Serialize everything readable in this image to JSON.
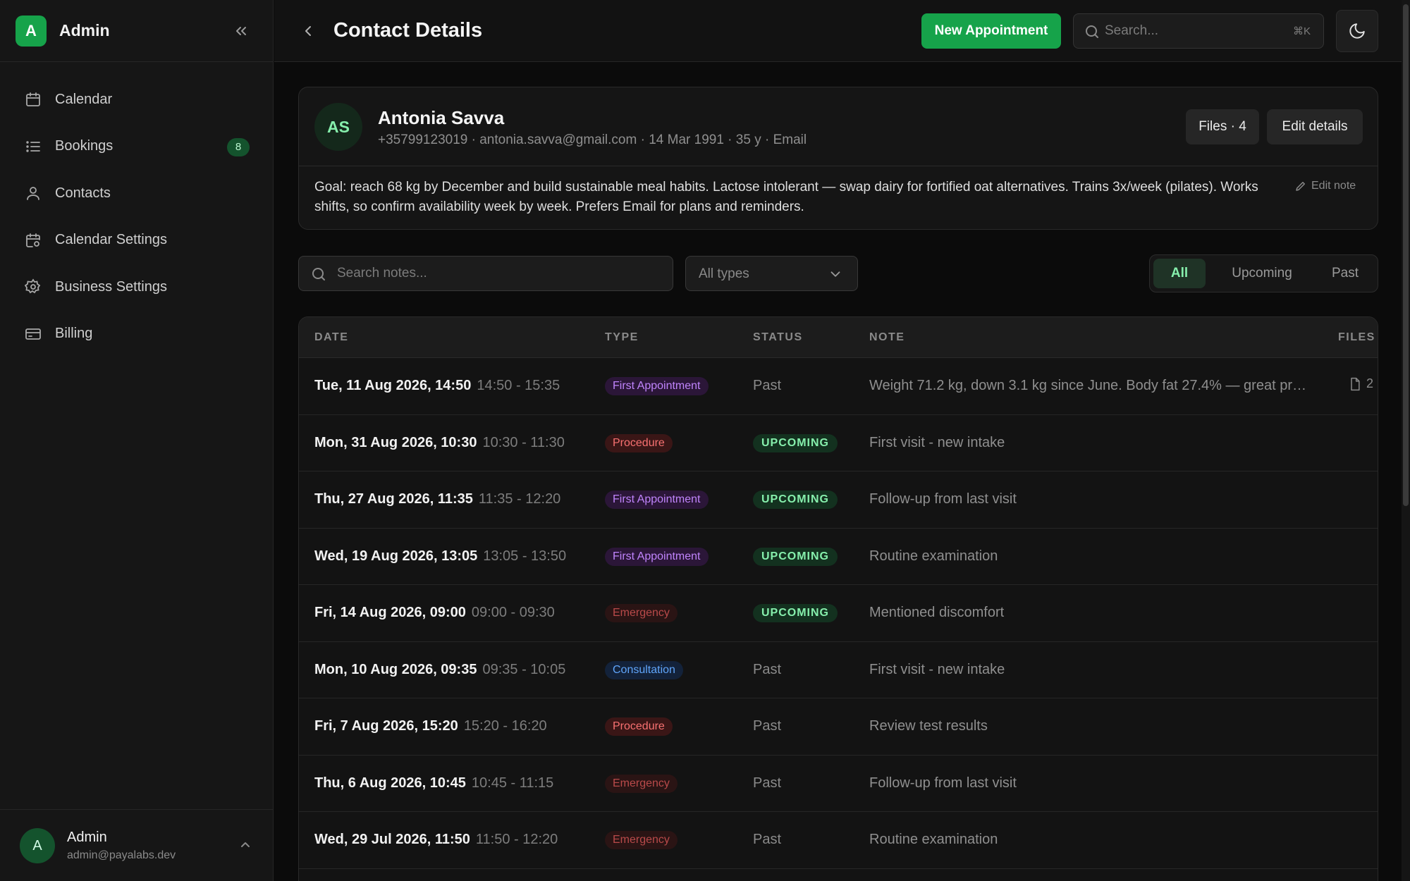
{
  "app": {
    "logo_letter": "A",
    "name": "Admin"
  },
  "sidebar": {
    "items": [
      {
        "label": "Calendar",
        "icon": "calendar-icon"
      },
      {
        "label": "Bookings",
        "icon": "list-icon",
        "badge": "8"
      },
      {
        "label": "Contacts",
        "icon": "user-icon"
      },
      {
        "label": "Calendar Settings",
        "icon": "calendar-settings-icon"
      },
      {
        "label": "Business Settings",
        "icon": "gear-icon"
      },
      {
        "label": "Billing",
        "icon": "credit-card-icon"
      }
    ],
    "user": {
      "avatar": "A",
      "name": "Admin",
      "email": "admin@payalabs.dev"
    }
  },
  "header": {
    "title": "Contact Details",
    "new_appointment_label": "New Appointment",
    "search_placeholder": "Search...",
    "search_shortcut": "⌘K"
  },
  "contact": {
    "initials": "AS",
    "name": "Antonia Savva",
    "meta": "+35799123019 · antonia.savva@gmail.com · 14 Mar 1991 · 35 y · Email",
    "files_label": "Files · 4",
    "edit_label": "Edit details",
    "note": "Goal: reach 68 kg by December and build sustainable meal habits. Lactose intolerant — swap dairy for fortified oat alternatives. Trains 3x/week (pilates). Works shifts, so confirm availability week by week. Prefers Email for plans and reminders.",
    "edit_note_label": "Edit note"
  },
  "filters": {
    "search_placeholder": "Search notes...",
    "type_value": "All types",
    "segments": [
      "All",
      "Upcoming",
      "Past"
    ],
    "active_segment": "All"
  },
  "table": {
    "headers": [
      "DATE",
      "TYPE",
      "STATUS",
      "NOTE",
      "FILES"
    ],
    "rows": [
      {
        "date": "Tue, 11 Aug 2026, 14:50",
        "time": "14:50 - 15:35",
        "type": "First Appointment",
        "status": "Past",
        "note": "Weight 71.2 kg, down 3.1 kg since June. Body fat 27.4% — great pro...",
        "files": "2"
      },
      {
        "date": "Mon, 31 Aug 2026, 10:30",
        "time": "10:30 - 11:30",
        "type": "Procedure",
        "status": "UPCOMING",
        "note": "First visit - new intake",
        "files": ""
      },
      {
        "date": "Thu, 27 Aug 2026, 11:35",
        "time": "11:35 - 12:20",
        "type": "First Appointment",
        "status": "UPCOMING",
        "note": "Follow-up from last visit",
        "files": ""
      },
      {
        "date": "Wed, 19 Aug 2026, 13:05",
        "time": "13:05 - 13:50",
        "type": "First Appointment",
        "status": "UPCOMING",
        "note": "Routine examination",
        "files": ""
      },
      {
        "date": "Fri, 14 Aug 2026, 09:00",
        "time": "09:00 - 09:30",
        "type": "Emergency",
        "status": "UPCOMING",
        "note": "Mentioned discomfort",
        "files": ""
      },
      {
        "date": "Mon, 10 Aug 2026, 09:35",
        "time": "09:35 - 10:05",
        "type": "Consultation",
        "status": "Past",
        "note": "First visit - new intake",
        "files": ""
      },
      {
        "date": "Fri, 7 Aug 2026, 15:20",
        "time": "15:20 - 16:20",
        "type": "Procedure",
        "status": "Past",
        "note": "Review test results",
        "files": ""
      },
      {
        "date": "Thu, 6 Aug 2026, 10:45",
        "time": "10:45 - 11:15",
        "type": "Emergency",
        "status": "Past",
        "note": "Follow-up from last visit",
        "files": ""
      },
      {
        "date": "Wed, 29 Jul 2026, 11:50",
        "time": "11:50 - 12:20",
        "type": "Emergency",
        "status": "Past",
        "note": "Routine examination",
        "files": ""
      }
    ]
  }
}
